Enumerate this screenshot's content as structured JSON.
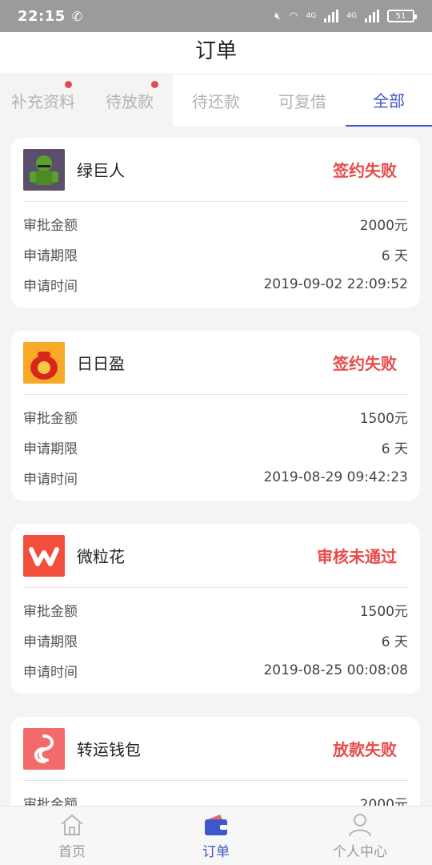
{
  "status_bar": {
    "time": "22:15",
    "battery": "51",
    "net1": "4G",
    "net2": "4G"
  },
  "header": {
    "title": "订单"
  },
  "tabs": [
    {
      "label": "补充资料",
      "has_dot": true
    },
    {
      "label": "待放款",
      "has_dot": true
    },
    {
      "label": "待还款",
      "has_dot": false
    },
    {
      "label": "可复借",
      "has_dot": false
    },
    {
      "label": "全部",
      "has_dot": false,
      "active": true
    }
  ],
  "labels": {
    "amount": "审批金额",
    "term": "申请期限",
    "time": "申请时间"
  },
  "orders": [
    {
      "name": "绿巨人",
      "status": "签约失败",
      "amount": "2000元",
      "term": "6 天",
      "time": "2019-09-02 22:09:52"
    },
    {
      "name": "日日盈",
      "status": "签约失败",
      "amount": "1500元",
      "term": "6 天",
      "time": "2019-08-29 09:42:23"
    },
    {
      "name": "微粒花",
      "status": "审核未通过",
      "amount": "1500元",
      "term": "6 天",
      "time": "2019-08-25 00:08:08"
    },
    {
      "name": "转运钱包",
      "status": "放款失败",
      "amount": "2000元"
    }
  ],
  "bottom_nav": [
    {
      "label": "首页",
      "icon": "home-icon"
    },
    {
      "label": "订单",
      "icon": "wallet-icon",
      "active": true
    },
    {
      "label": "个人中心",
      "icon": "person-icon"
    }
  ],
  "colors": {
    "accent": "#3f57c8",
    "status_red": "#e84a4a",
    "dot_red": "#e64b4b"
  }
}
